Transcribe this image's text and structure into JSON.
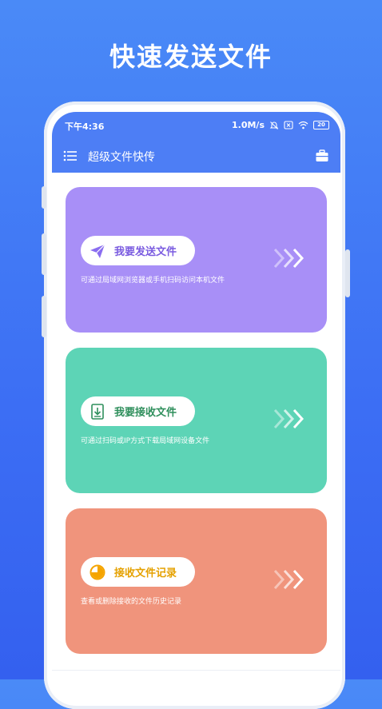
{
  "headline": "快速发送文件",
  "status_bar": {
    "time": "下午4:36",
    "speed": "1.0M/s",
    "battery": "20"
  },
  "toolbar": {
    "title": "超级文件快传"
  },
  "cards": [
    {
      "label": "我要发送文件",
      "desc": "可通过局域网浏览器或手机扫码访问本机文件",
      "color": "#a88ff7",
      "label_color": "#7a5be0",
      "icon": "paper-plane-icon"
    },
    {
      "label": "我要接收文件",
      "desc": "可通过扫码或IP方式下载局域网设备文件",
      "color": "#5dd4b6",
      "label_color": "#2f8f5c",
      "icon": "download-file-icon"
    },
    {
      "label": "接收文件记录",
      "desc": "查看或删除接收的文件历史记录",
      "color": "#f0947c",
      "label_color": "#e5a100",
      "icon": "pie-chart-icon"
    }
  ],
  "colors": {
    "background": "#3c6ef4",
    "bar": "#4d7ef5"
  }
}
